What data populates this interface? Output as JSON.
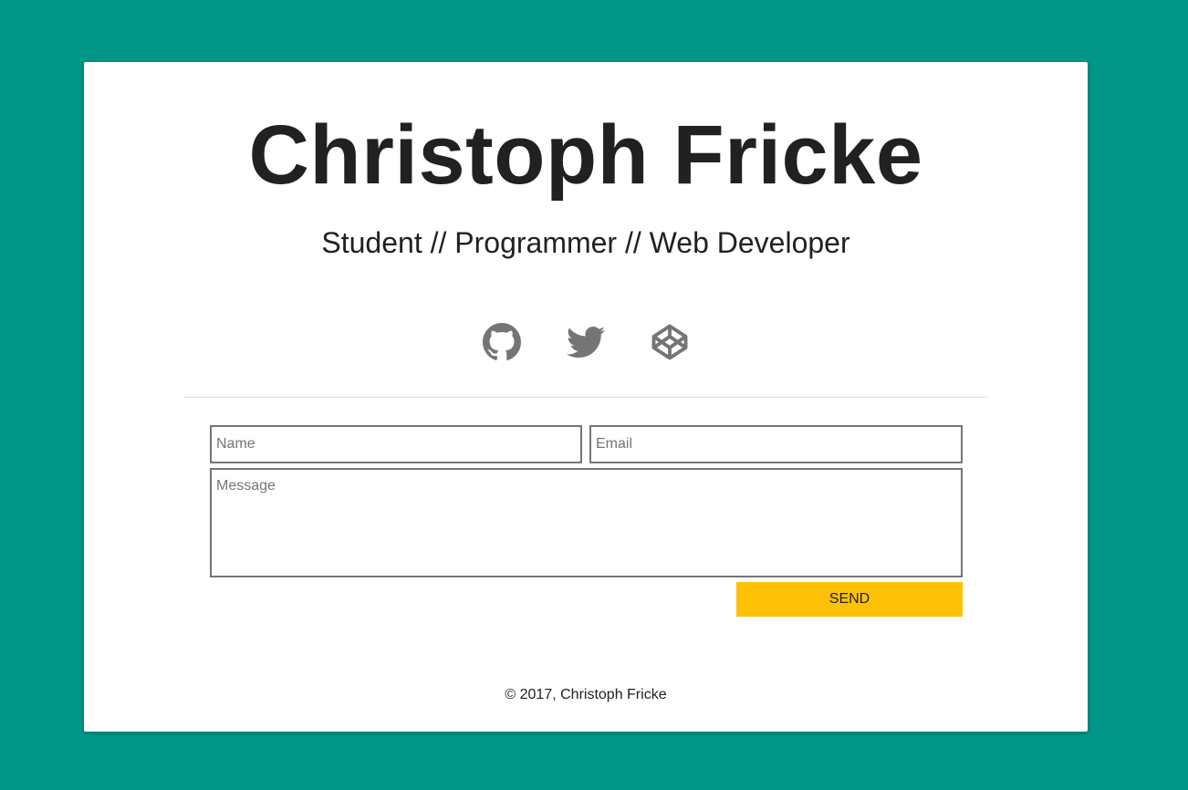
{
  "header": {
    "title": "Christoph Fricke",
    "subtitle": "Student // Programmer // Web Developer"
  },
  "social": {
    "icons": [
      "github-icon",
      "twitter-icon",
      "codepen-icon"
    ],
    "icon_color": "#757575"
  },
  "contact_form": {
    "name_placeholder": "Name",
    "email_placeholder": "Email",
    "message_placeholder": "Message",
    "send_label": "SEND"
  },
  "footer": {
    "copyright": "© 2017, Christoph Fricke"
  },
  "colors": {
    "background": "#009688",
    "card": "#ffffff",
    "accent": "#ffc107",
    "text": "#212121"
  }
}
